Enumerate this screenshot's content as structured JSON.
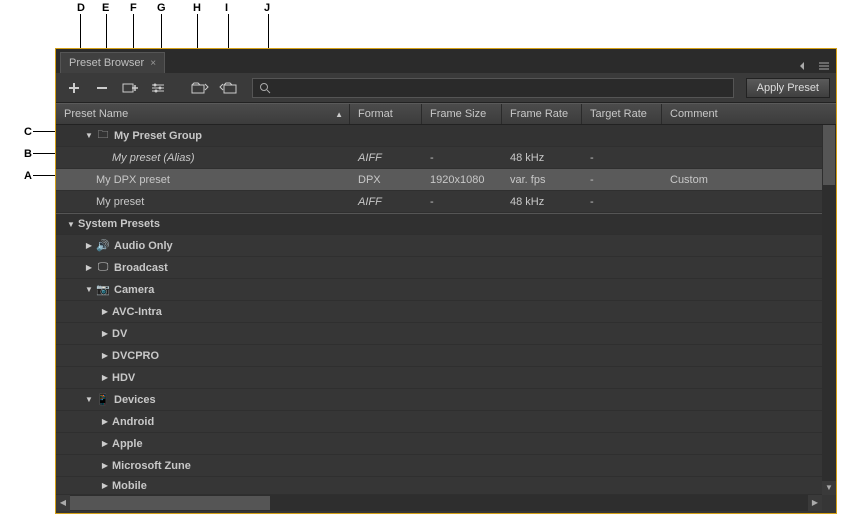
{
  "callouts": {
    "A": "A",
    "B": "B",
    "C": "C",
    "D": "D",
    "E": "E",
    "F": "F",
    "G": "G",
    "H": "H",
    "I": "I",
    "J": "J"
  },
  "panel": {
    "title": "Preset Browser"
  },
  "toolbar": {
    "apply_label": "Apply Preset",
    "search_placeholder": ""
  },
  "columns": {
    "name": "Preset Name",
    "format": "Format",
    "framesize": "Frame Size",
    "framerate": "Frame Rate",
    "targetrate": "Target Rate",
    "comment": "Comment"
  },
  "rows": {
    "group0": {
      "label": "My Preset Group"
    },
    "alias": {
      "label": "My preset (Alias)",
      "format": "AIFF",
      "framesize": "-",
      "framerate": "48 kHz",
      "targetrate": "-",
      "comment": ""
    },
    "dpx": {
      "label": "My DPX preset",
      "format": "DPX",
      "framesize": "1920x1080",
      "framerate": "var. fps",
      "targetrate": "-",
      "comment": "Custom"
    },
    "myp": {
      "label": "My preset",
      "format": "AIFF",
      "framesize": "-",
      "framerate": "48 kHz",
      "targetrate": "-",
      "comment": ""
    },
    "sys": {
      "label": "System Presets"
    },
    "audioonly": {
      "label": "Audio Only"
    },
    "broadcast": {
      "label": "Broadcast"
    },
    "camera": {
      "label": "Camera"
    },
    "avcintra": {
      "label": "AVC-Intra"
    },
    "dv": {
      "label": "DV"
    },
    "dvcpro": {
      "label": "DVCPRO"
    },
    "hdv": {
      "label": "HDV"
    },
    "devices": {
      "label": "Devices"
    },
    "android": {
      "label": "Android"
    },
    "apple": {
      "label": "Apple"
    },
    "zune": {
      "label": "Microsoft Zune"
    },
    "mobile": {
      "label": "Mobile"
    }
  }
}
